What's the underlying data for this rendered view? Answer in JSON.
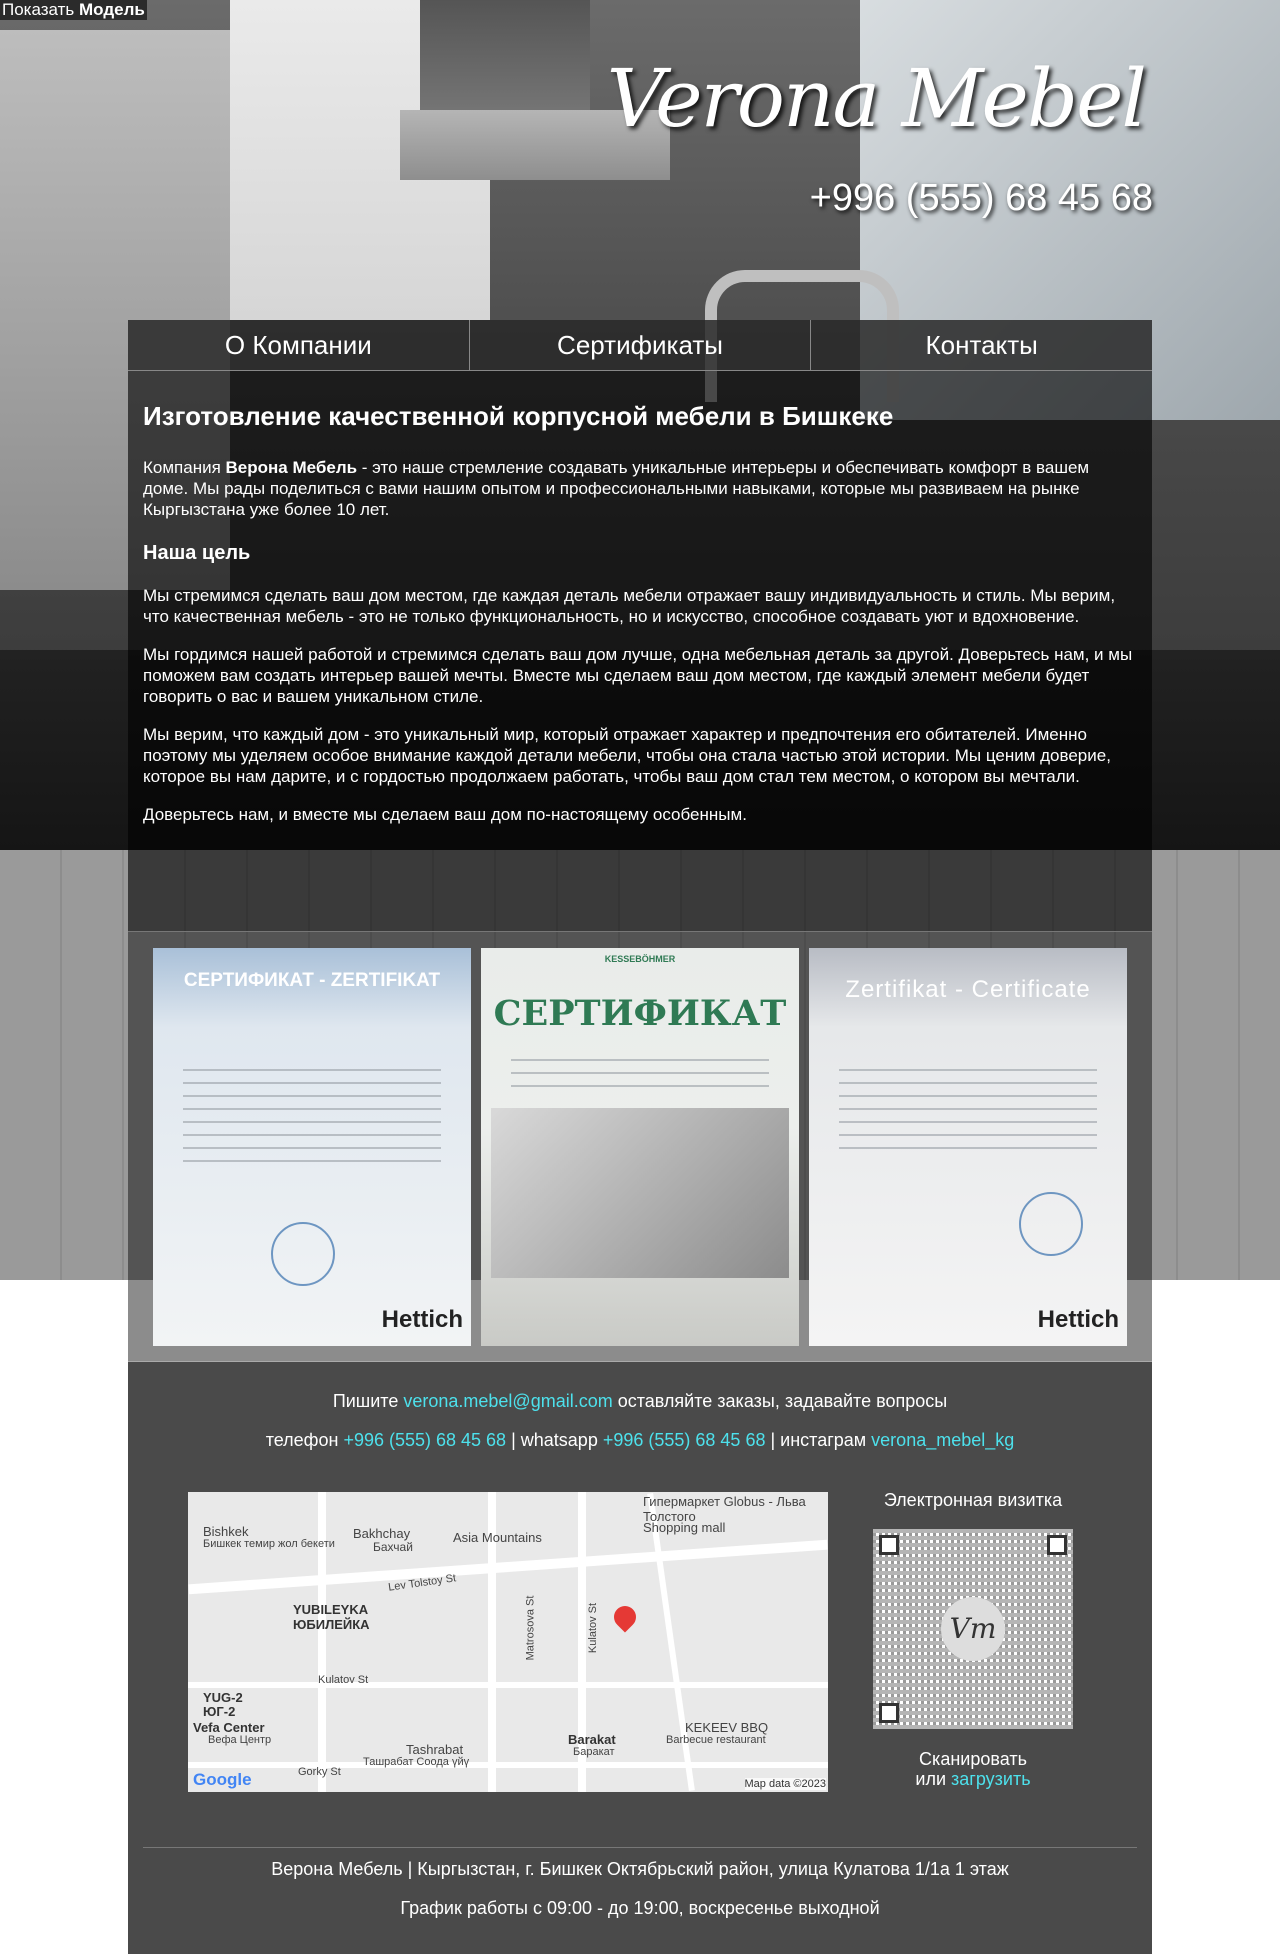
{
  "toggle": {
    "prefix": "Показать",
    "bold": "Модель"
  },
  "header": {
    "brand": "Verona Mebel",
    "phone": "+996 (555) 68 45 68"
  },
  "nav": [
    {
      "label": "О Компании"
    },
    {
      "label": "Сертификаты"
    },
    {
      "label": "Контакты"
    }
  ],
  "content": {
    "title": "Изготовление качественной корпусной мебели в Бишкеке",
    "intro_prefix": "Компания ",
    "intro_bold": "Верона Мебель",
    "intro_rest": " - это наше стремление создавать уникальные интерьеры и обеспечивать комфорт в вашем доме. Мы рады поделиться с вами нашим опытом и профессиональными навыками, которые мы развиваем на рынке Кыргызстана уже более 10 лет.",
    "goal_heading": "Наша цель",
    "paragraphs": [
      "Мы стремимся сделать ваш дом местом, где каждая деталь мебели отражает вашу индивидуальность и стиль. Мы верим, что качественная мебель - это не только функциональность, но и искусство, способное создавать уют и вдохновение.",
      "Мы гордимся нашей работой и стремимся сделать ваш дом лучше, одна мебельная деталь за другой. Доверьтесь нам, и мы поможем вам создать интерьер вашей мечты. Вместе мы сделаем ваш дом местом, где каждый элемент мебели будет говорить о вас и вашем уникальном стиле.",
      "Мы верим, что каждый дом - это уникальный мир, который отражает характер и предпочтения его обитателей. Именно поэтому мы уделяем особое внимание каждой детали мебели, чтобы она стала частью этой истории. Мы ценим доверие, которое вы нам дарите, и с гордостью продолжаем работать, чтобы ваш дом стал тем местом, о котором вы мечтали.",
      "Доверьтесь нам, и вместе мы сделаем ваш дом по-настоящему особенным."
    ]
  },
  "certificates": [
    {
      "title": "СЕРТИФИКАТ - ZERTIFIKAT",
      "mark": "Hettich"
    },
    {
      "title": "СЕРТИФИКАТ",
      "mark": "KESSEBÖHMER"
    },
    {
      "title": "Zertifikat - Certificate",
      "mark": "Hettich"
    }
  ],
  "footer": {
    "write_prefix": "Пишите ",
    "email": "verona.mebel@gmail.com",
    "write_suffix": " оставляйте заказы, задавайте вопросы",
    "phone_label": "телефон ",
    "phone": "+996 (555) 68 45 68",
    "whatsapp_label": "|  whatsapp ",
    "whatsapp": "+996 (555) 68 45 68",
    "instagram_label": "|  инстаграм ",
    "instagram": "verona_mebel_kg",
    "vcard_title": "Электронная визитка",
    "vcard_logo": "Vm",
    "scan": "Сканировать",
    "or": "или ",
    "download": "загрузить",
    "address": "Верона Мебель | Кыргызстан, г. Бишкек Октябрьский район, улица Кулатова 1/1а 1 этаж",
    "hours": "График работы с 09:00 - до 19:00, воскресенье выходной"
  },
  "map": {
    "labels": [
      "Гипермаркет Globus - Льва Толстого",
      "Shopping mall",
      "Bishkek",
      "Бишкек темир жол бекети",
      "Bakhchay",
      "Бахчай",
      "Asia Mountains",
      "Lev Tolstoy St",
      "YUBILEYKA",
      "ЮБИЛЕЙКА",
      "Matrosova St",
      "Kulatov St",
      "Kulatov St",
      "YUG-2",
      "ЮГ-2",
      "Vefa Center",
      "Вефа Центр",
      "Tashrabat",
      "Ташрабат Соода үйү",
      "Barakat",
      "Баракат",
      "KEKEEV BBQ",
      "Barbecue restaurant",
      "Gorky St"
    ],
    "google": "Google",
    "attribution": "Map data ©2023"
  }
}
